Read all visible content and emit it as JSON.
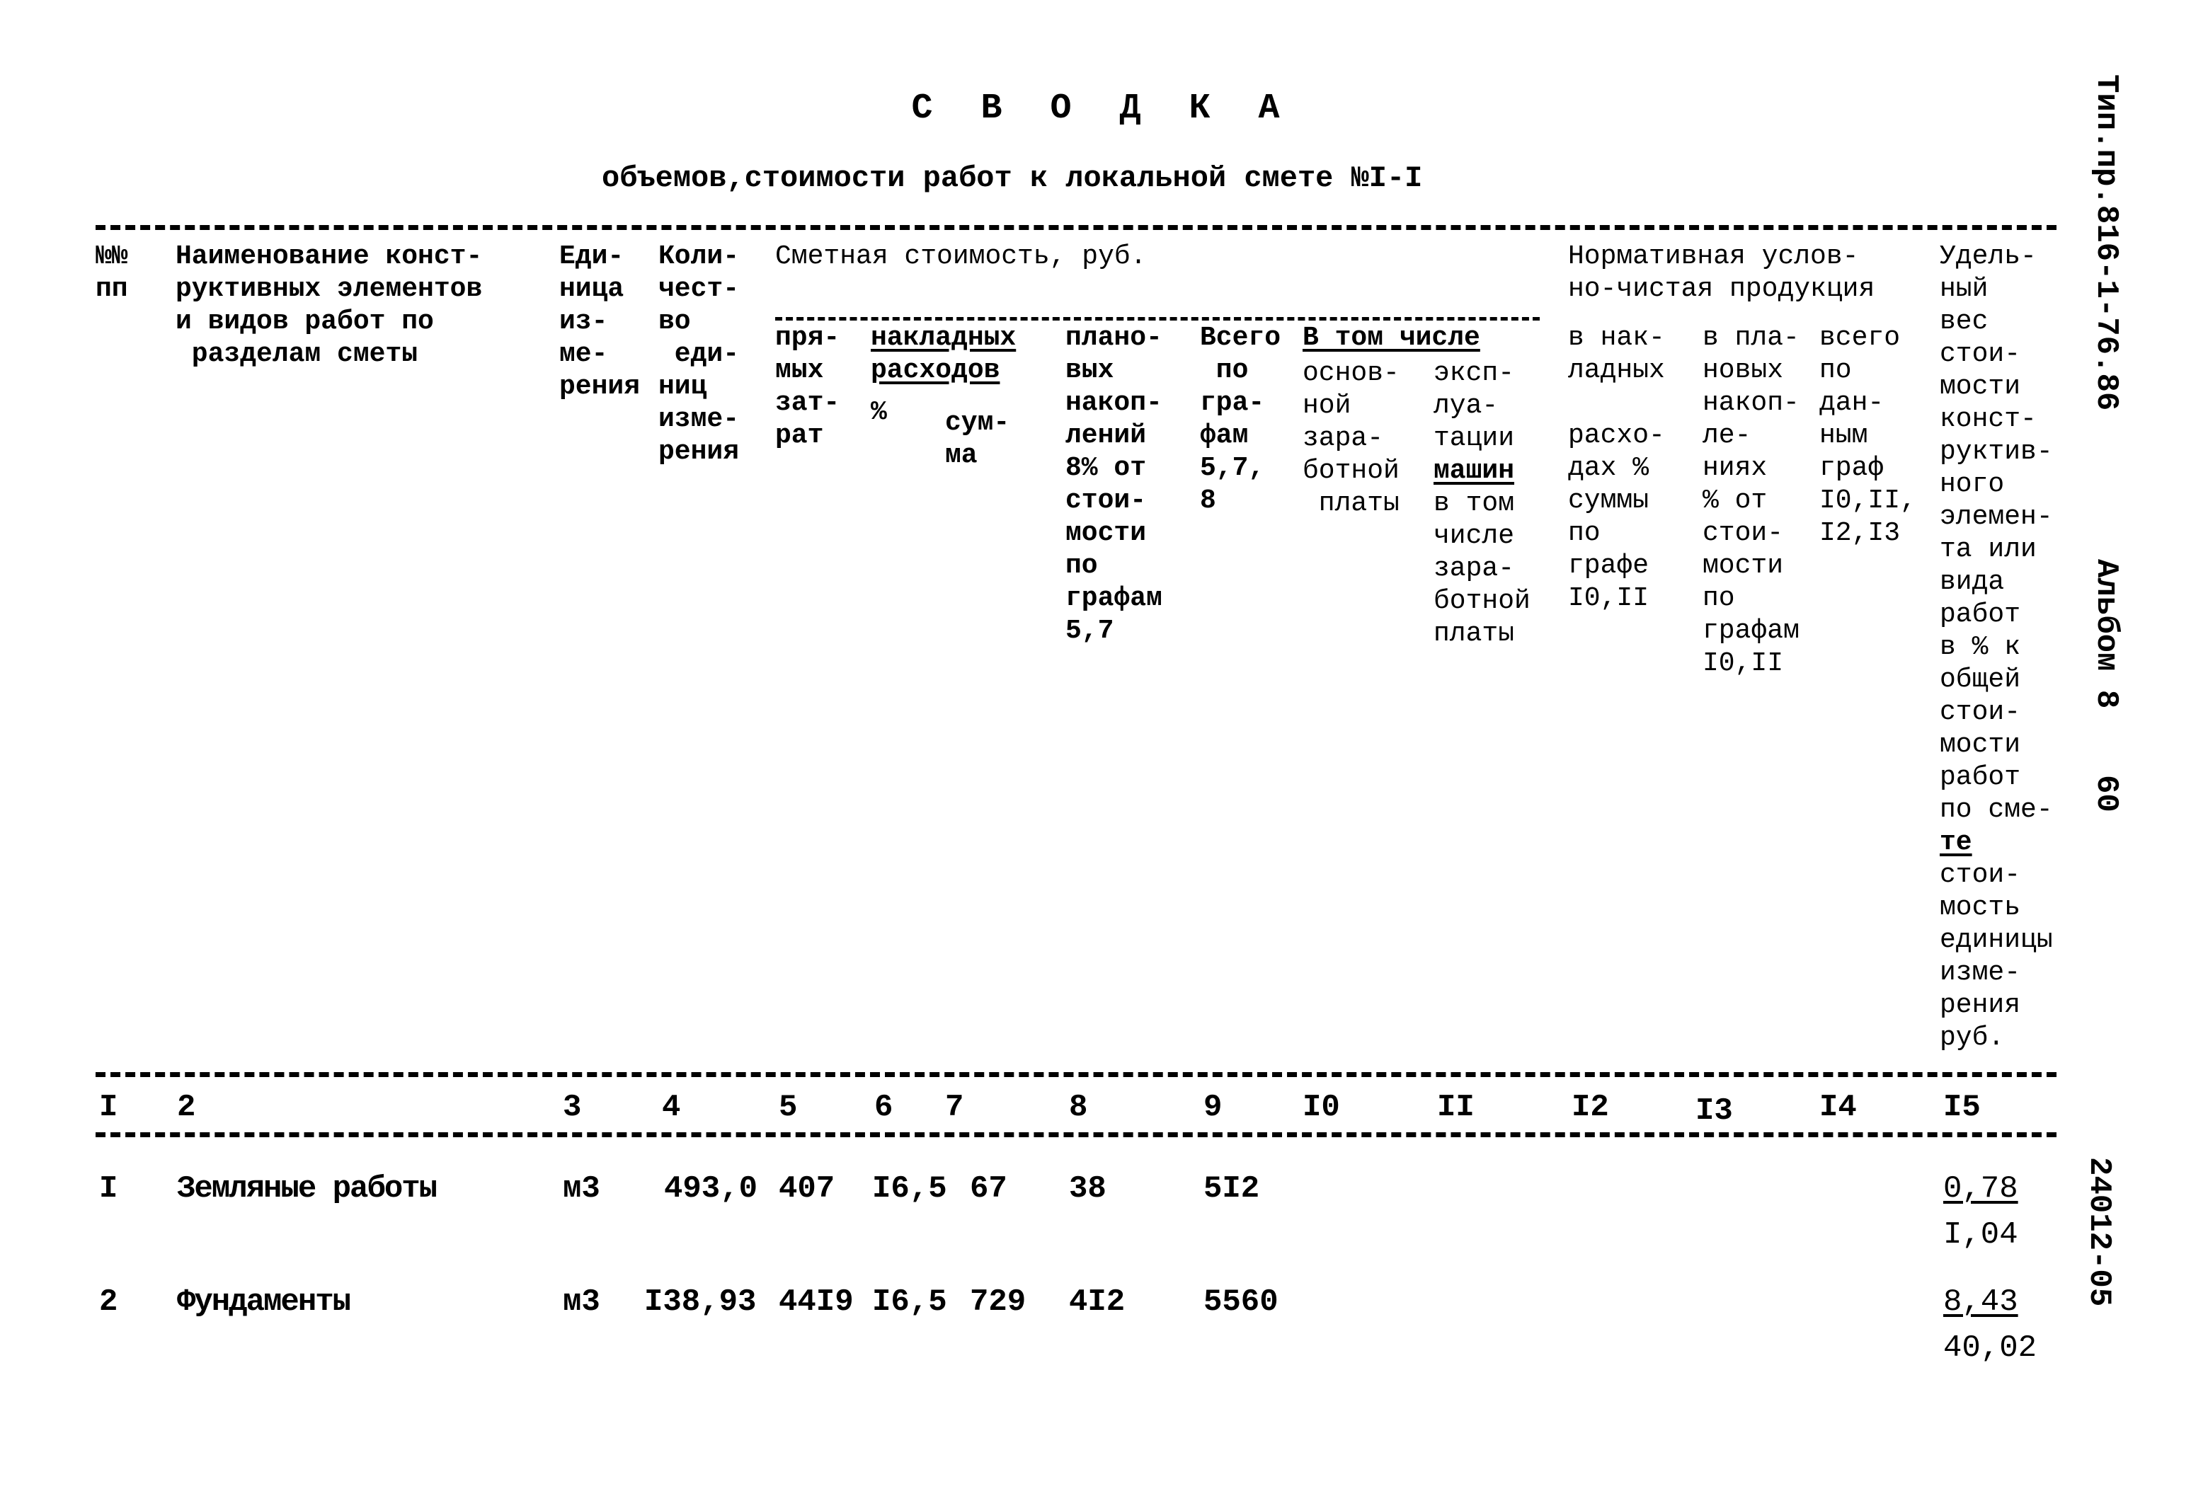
{
  "document": {
    "title_letters": [
      "С",
      "В",
      "О",
      "Д",
      "К",
      "А"
    ],
    "subtitle": "объемов,стоимости работ к локальной смете №I-I",
    "side_stamp_top": "Тип.пр.816-1-76.86",
    "side_stamp_album": "Альбом 8",
    "side_page_number": "60",
    "side_stamp_bottom": "24012-05"
  },
  "table": {
    "headers": {
      "col1": "№№\nпп",
      "col2": "Наименование конст-\nруктивных элементов\nи видов работ по\n раздeлам сметы",
      "col3": "Еди-\nница\nиз-\nме-\nрения",
      "col4": "Коли-\nчест-\nво\n еди-\nниц\nизме-\nрения",
      "group_cost": "Сметная стоимость, руб.",
      "col5": "пря-\nмых\nзат-\nрат",
      "group_overhead": "накладных\nрасходов",
      "col6": "%",
      "col7": "сум-\nма",
      "col8": "плано-\nвых\nнакоп-\nлений\n8% от\nстои-\nмости\nпо\nграфам\n5,7",
      "col9": "Всего\n по\nгра-\nфам\n5,7,\n8",
      "group_incl": "В том числе",
      "col10": "основ-\nной\nзара-\nботной\n платы",
      "col11_top": "эксп-\nлуа-\nтации",
      "col11_under": "машин",
      "col11_rest": "в том\nчисле\nзара-\nботной\nплаты",
      "group_norm": "Нормативная услов-\nно-чистая продукция",
      "col12": "в нак-\nладных\n\nрасхо-\nдах %\nсуммы\nпо\nграфе\nI0,II",
      "col13": "в пла-\nновых\nнакоп-\nле-\nниях\n% от\nстои-\nмости\nпо\nграфам\nI0,II",
      "col14": "всего\nпо\nдан-\nным\nграф\nI0,II,\nI2,I3",
      "col15_top": "Удель-\nный\nвес\nстои-\nмости\nконст-\nруктив-\nного\nэлемен-\nта или\nвида\nработ\nв % к\nобщей\nстои-\nмости\nработ\nпо сме-",
      "col15_under": "те",
      "col15_rest": "стои-\nмость\nединицы\nизме-\nрения\nруб."
    },
    "column_numbers": [
      "I",
      "2",
      "3",
      "4",
      "5",
      "6",
      "7",
      "8",
      "9",
      "I0",
      "II",
      "I2",
      "I3",
      "I4",
      "I5"
    ],
    "rows": [
      {
        "num": "I",
        "name": "Земляные работы",
        "unit": "м3",
        "quantity": "493,0",
        "direct_costs": "407",
        "overhead_pct": "I6,5",
        "overhead_sum": "67",
        "planned_savings": "38",
        "total": "5I2",
        "share_pct": "0,78",
        "unit_cost": "I,04"
      },
      {
        "num": "2",
        "name": "Фундаменты",
        "unit": "м3",
        "quantity": "I38,93",
        "direct_costs": "44I9",
        "overhead_pct": "I6,5",
        "overhead_sum": "729",
        "planned_savings": "4I2",
        "total": "5560",
        "share_pct": "8,43",
        "unit_cost": "40,02"
      }
    ]
  }
}
